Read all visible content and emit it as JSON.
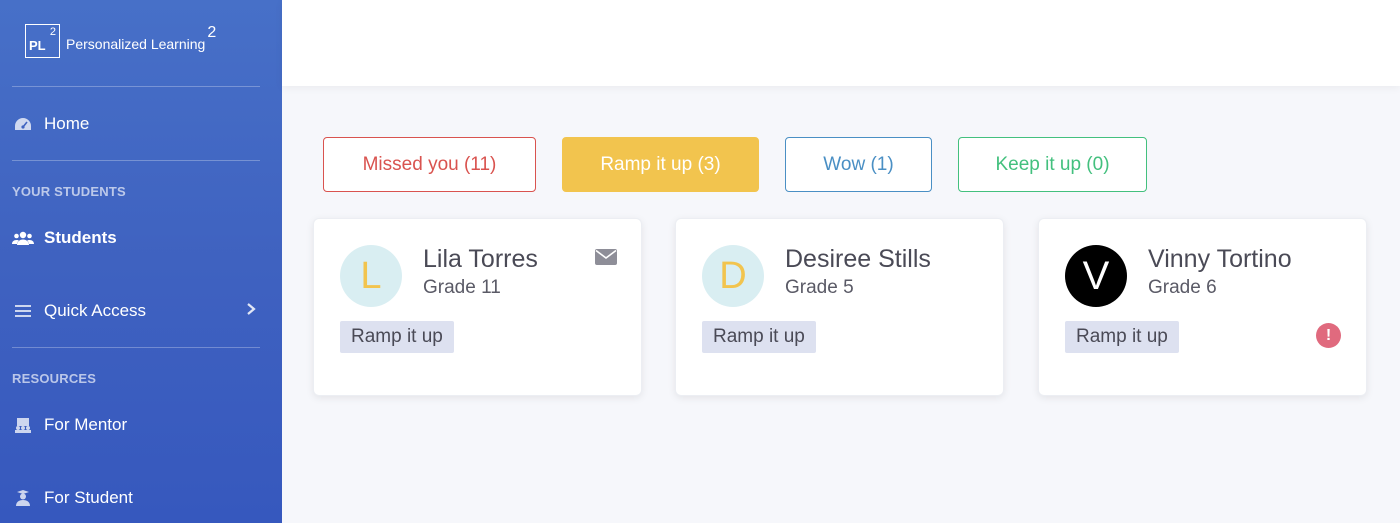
{
  "brand": {
    "logo_mark": "PL",
    "logo_sup": "2",
    "name": "Personalized Learning",
    "name_sup": "2"
  },
  "sidebar": {
    "home": {
      "label": "Home",
      "icon": "dashboard-icon"
    },
    "section_students": "YOUR STUDENTS",
    "students": {
      "label": "Students",
      "icon": "users-icon"
    },
    "quick_access": {
      "label": "Quick Access",
      "icon": "list-icon"
    },
    "section_resources": "RESOURCES",
    "for_mentor": {
      "label": "For Mentor",
      "icon": "chalkboard-icon"
    },
    "for_student": {
      "label": "For Student",
      "icon": "graduate-icon"
    }
  },
  "filters": {
    "missed": "Missed you (11)",
    "ramp": "Ramp it up (3)",
    "wow": "Wow (1)",
    "keep": "Keep it up (0)"
  },
  "students": [
    {
      "initial": "L",
      "name": "Lila Torres",
      "grade": "Grade 11",
      "tag": "Ramp it up"
    },
    {
      "initial": "D",
      "name": "Desiree Stills",
      "grade": "Grade 5",
      "tag": "Ramp it up"
    },
    {
      "initial": "V",
      "name": "Vinny Tortino",
      "grade": "Grade 6",
      "tag": "Ramp it up",
      "alert": "!"
    }
  ],
  "colors": {
    "sidebar": "#3f62c0",
    "missed": "#d9534f",
    "ramp": "#f2c44e",
    "wow": "#4a8fc4",
    "keep": "#43c07e",
    "alert": "#e06a7e"
  }
}
